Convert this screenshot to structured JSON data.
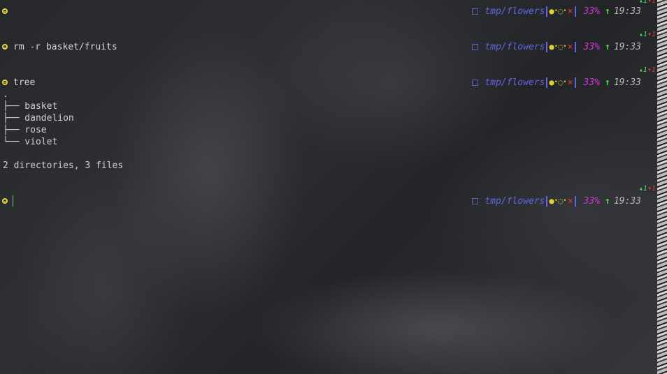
{
  "status": {
    "ahead_marker": "▴1",
    "behind_marker": "▾1",
    "path": "tmp/flowers",
    "git_dots": [
      "●",
      "•",
      "◌",
      "•"
    ],
    "git_x": "×",
    "battery": "33%",
    "arrow": "↑",
    "time": "19:33"
  },
  "commands": [
    {
      "text": ""
    },
    {
      "text": "rm -r basket/fruits"
    },
    {
      "text": "tree"
    },
    {
      "text": ""
    }
  ],
  "tree_output": {
    "root": ".",
    "entries": [
      "├── basket",
      "├── dandelion",
      "├── rose",
      "└── violet"
    ],
    "summary": "2 directories, 3 files"
  },
  "colors": {
    "accent_path": "#6266e0",
    "battery": "#d03ad6",
    "arrow": "#4fe04f",
    "prompt": "#e8d83a"
  },
  "icons": [
    "prompt-icon",
    "directory-icon",
    "git-status-icons",
    "upload-arrow-icon"
  ]
}
